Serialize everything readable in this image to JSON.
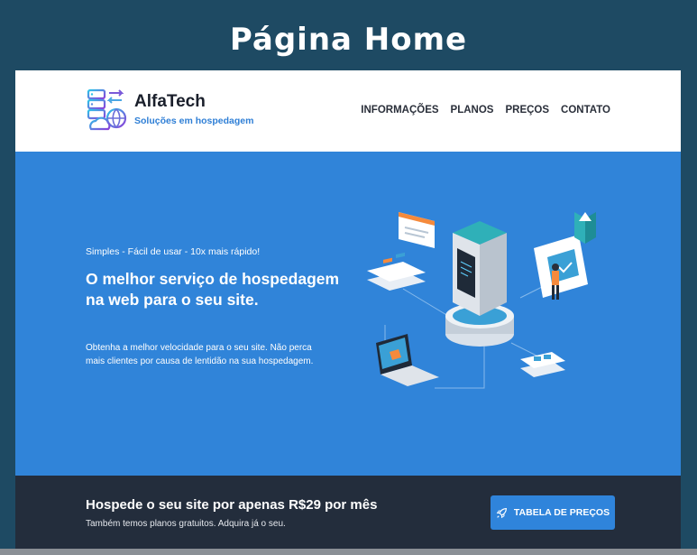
{
  "page": {
    "heading": "Página Home"
  },
  "header": {
    "brand_name": "AlfaTech",
    "brand_tagline": "Soluções em hospedagem",
    "logo_icon": "server-cloud-logo-icon",
    "nav": [
      "INFORMAÇÕES",
      "PLANOS",
      "PREÇOS",
      "CONTATO"
    ]
  },
  "hero": {
    "kicker": "Simples - Fácil de usar - 10x mais rápido!",
    "title": "O melhor serviço de hospedagem na web para o seu site.",
    "text": "Obtenha a melhor velocidade para o seu site. Não perca mais clientes por causa de lentidão na sua hospedagem.",
    "illustration": "server-hosting-isometric-illustration"
  },
  "cta": {
    "title": "Hospede o seu site por apenas R$29 por mês",
    "subtitle": "Também temos planos gratuitos. Adquira já o seu.",
    "button_label": "TABELA DE PREÇOS",
    "button_icon": "rocket-icon"
  },
  "colors": {
    "background": "#1e4a63",
    "hero": "#3084d9",
    "cta_band": "#232d3c",
    "accent": "#2f84db"
  }
}
